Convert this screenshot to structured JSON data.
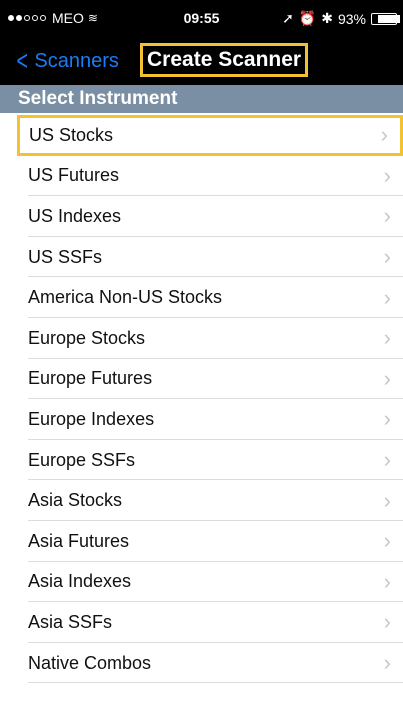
{
  "status_bar": {
    "carrier": "MEO",
    "time": "09:55",
    "battery": "93%",
    "signal_filled": 2,
    "signal_total": 5
  },
  "nav": {
    "back_label": "Scanners",
    "title": "Create Scanner"
  },
  "section": {
    "header": "Select Instrument"
  },
  "instruments": [
    {
      "label": "US Stocks"
    },
    {
      "label": "US Futures"
    },
    {
      "label": "US Indexes"
    },
    {
      "label": "US SSFs"
    },
    {
      "label": "America Non-US Stocks"
    },
    {
      "label": "Europe Stocks"
    },
    {
      "label": "Europe Futures"
    },
    {
      "label": "Europe Indexes"
    },
    {
      "label": "Europe SSFs"
    },
    {
      "label": "Asia Stocks"
    },
    {
      "label": "Asia Futures"
    },
    {
      "label": "Asia Indexes"
    },
    {
      "label": "Asia SSFs"
    },
    {
      "label": "Native Combos"
    }
  ],
  "colors": {
    "accent": "#1a7cf6",
    "highlight_border": "#f2c230",
    "section_header_bg": "#7b8fa4"
  },
  "icons": {
    "row_chevron": "chevron-right-icon",
    "back": "chevron-left-icon"
  }
}
